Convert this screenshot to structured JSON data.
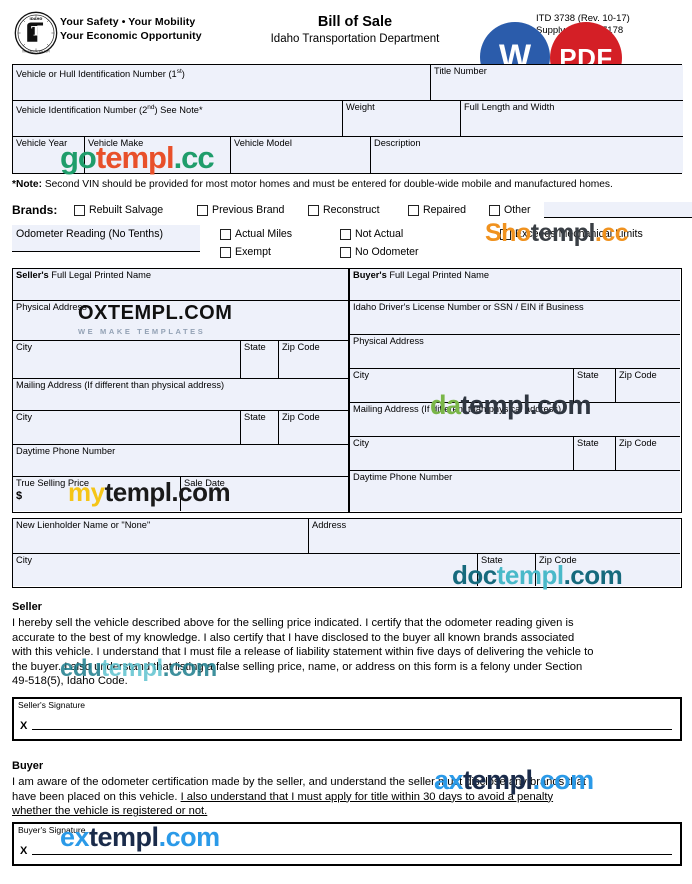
{
  "header": {
    "tagline_line1": "Your Safety  •   Your Mobility",
    "tagline_line2": "Your Economic Opportunity",
    "title": "Bill of Sale",
    "subtitle": "Idaho Transportation Department",
    "form_number": "ITD 3738   (Rev. 10-17)",
    "supply_number": "Supply # 019677178",
    "seal_top_text": "IDAHO",
    "seal_bottom_text": "TRANSPORTATION DEPARTMENT",
    "seal_center": "ITD",
    "badge_word": "W",
    "badge_pdf": "PDF"
  },
  "vehicle": {
    "vin1_label": "Vehicle or Hull Identification Number (1",
    "vin1_sup": "st",
    "vin1_label_end": ")",
    "title_number_label": "Title Number",
    "vin2_label": "Vehicle Identification Number (2",
    "vin2_sup": "nd",
    "vin2_label_end": ") See Note*",
    "weight_label": "Weight",
    "full_length_width_label": "Full Length and Width",
    "year_label": "Vehicle Year",
    "make_label": "Vehicle Make",
    "model_label": "Vehicle Model",
    "description_label": "Description"
  },
  "note": {
    "prefix": "*Note:",
    "text": " Second VIN should be provided for most motor homes and must be entered for double-wide mobile and manufactured homes."
  },
  "brands": {
    "label": "Brands:",
    "options": [
      "Rebuilt Salvage",
      "Previous Brand",
      "Reconstruct",
      "Repaired",
      "Other"
    ]
  },
  "odometer": {
    "label": "Odometer Reading (No Tenths)",
    "options": [
      "Actual Miles",
      "Not Actual",
      "Exceeds Mechanical Limits",
      "Exempt",
      "No Odometer"
    ]
  },
  "seller": {
    "name_label_bold": "Seller's",
    "name_label_rest": " Full Legal Printed Name",
    "physical_address_label": "Physical Address",
    "city_label": "City",
    "state_label": "State",
    "zip_label": "Zip Code",
    "mailing_address_label": "Mailing Address (If different than physical address)",
    "city2_label": "City",
    "state2_label": "State",
    "zip2_label": "Zip Code",
    "daytime_phone_label": "Daytime Phone Number",
    "true_selling_price_label": "True Selling Price",
    "dollar_sign": "$",
    "sale_date_label": "Sale Date"
  },
  "buyer": {
    "name_label_bold": "Buyer's",
    "name_label_rest": " Full Legal Printed Name",
    "dl_label": "Idaho Driver's License Number or SSN / EIN if Business",
    "physical_address_label": "Physical Address",
    "city_label": "City",
    "state_label": "State",
    "zip_label": "Zip Code",
    "mailing_address_label": "Mailing Address (If different than physical address)",
    "city2_label": "City",
    "state2_label": "State",
    "zip2_label": "Zip Code",
    "daytime_phone_label": "Daytime Phone Number"
  },
  "lienholder": {
    "name_label": "New Lienholder Name or \"None\"",
    "address_label": "Address",
    "city_label": "City",
    "state_label": "State",
    "zip_label": "Zip Code"
  },
  "seller_cert": {
    "heading": "Seller",
    "line1": "I hereby sell the vehicle described above for the selling price indicated.  I certify that the odometer reading given is",
    "line2": "accurate to the best of my knowledge.  I also certify that I have disclosed to the buyer all known brands associated",
    "line3": "with this vehicle.  I understand that I must file a release of liability statement within five days of delivering the vehicle to",
    "line4": "the buyer.  I also understand that listing a false selling price, name, or address on this form is a felony under Section",
    "line5": "49-518(5), Idaho Code.",
    "signature_label": "Seller's Signature",
    "x_mark": "X"
  },
  "buyer_cert": {
    "heading": "Buyer",
    "line1": "I am aware of the odometer certification made by the seller, and understand the seller must disclose any brands that",
    "line2_plain": "have been placed on this vehicle.  ",
    "line2_underlined": "I also understand that I must apply for title within 30 days to avoid a penalty",
    "line3_underlined": "whether the vehicle is registered or not.",
    "signature_label": "Buyer's Signature",
    "x_mark": "X"
  },
  "watermarks": [
    {
      "id": "gotempl",
      "a": "go",
      "b": "templ",
      "c": ".cc"
    },
    {
      "id": "shotempl",
      "a": "Sho",
      "b": "templ",
      "c": ".cc"
    },
    {
      "id": "oxtempl",
      "t1": "OXTEMPL.COM",
      "t2": "WE MAKE TEMPLATES"
    },
    {
      "id": "datempl",
      "a": "da",
      "b": "templ",
      "c": ".com"
    },
    {
      "id": "mytempl",
      "a": "my",
      "b": "templ",
      "c": ".com"
    },
    {
      "id": "doctempl",
      "a": "doc",
      "b": "templ",
      "c": ".com"
    },
    {
      "id": "edutempl",
      "a": "edu",
      "b": "templ",
      "c": ".com"
    },
    {
      "id": "axtempl",
      "a": "ax",
      "b": "templ",
      "c": ".com"
    },
    {
      "id": "extempl",
      "a": "ex",
      "b": "templ",
      "c": ".com"
    }
  ],
  "colors": {
    "field_fill": "#eef1fa",
    "word_badge": "#2b5cab",
    "pdf_badge": "#d41f26",
    "rule": "#000000"
  }
}
